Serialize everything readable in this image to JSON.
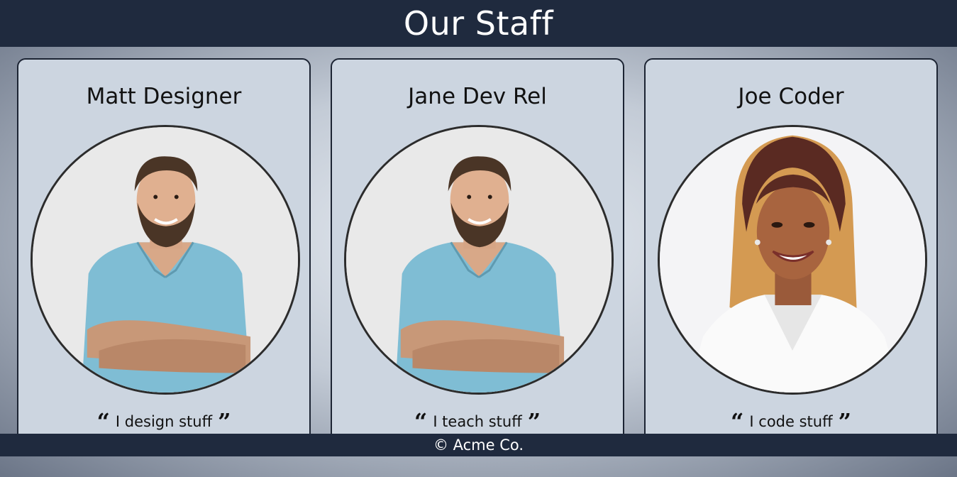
{
  "header": {
    "title": "Our Staff"
  },
  "staff": [
    {
      "name": "Matt Designer",
      "quote": "I design stuff",
      "open_quote": "“",
      "close_quote": "”"
    },
    {
      "name": "Jane Dev Rel",
      "quote": "I teach stuff",
      "open_quote": "“",
      "close_quote": "”"
    },
    {
      "name": "Joe Coder",
      "quote": "I code stuff",
      "open_quote": "“",
      "close_quote": "”"
    }
  ],
  "footer": {
    "text": "© Acme Co."
  },
  "colors": {
    "header_bg": "#1f2a3e",
    "card_bg": "#ccd5e0",
    "shirt": "#7fbdd4",
    "hair_dark": "#5a2a22",
    "hair_light": "#d49a52"
  }
}
